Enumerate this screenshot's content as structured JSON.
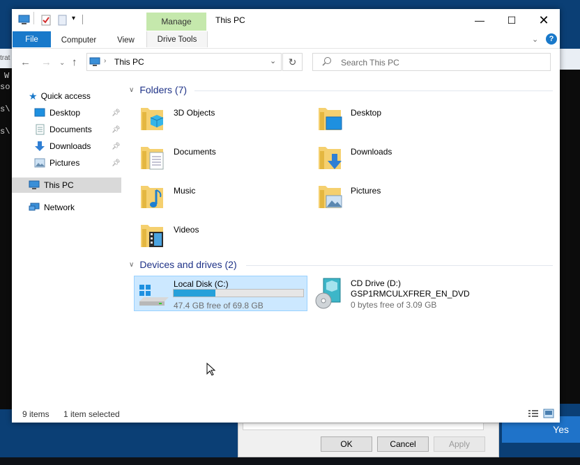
{
  "background": {
    "terminal_lines": [
      "W",
      "so",
      "s\\",
      "s\\"
    ],
    "top_strip": "trat",
    "yes_label": "Yes",
    "dialog": {
      "ok": "OK",
      "cancel": "Cancel",
      "apply": "Apply"
    }
  },
  "window": {
    "title": "This PC",
    "contextual_tab": "Manage",
    "ribbon_tabs": [
      "File",
      "Computer",
      "View",
      "Drive Tools"
    ],
    "help": "?"
  },
  "address": {
    "location": "This PC",
    "search_placeholder": "Search This PC"
  },
  "nav": {
    "quick_access": "Quick access",
    "pinned": [
      "Desktop",
      "Documents",
      "Downloads",
      "Pictures"
    ],
    "this_pc": "This PC",
    "network": "Network"
  },
  "content": {
    "folders_header": "Folders (7)",
    "folders": [
      "3D Objects",
      "Desktop",
      "Documents",
      "Downloads",
      "Music",
      "Pictures",
      "Videos"
    ],
    "devices_header": "Devices and drives (2)",
    "drives": [
      {
        "name": "Local Disk (C:)",
        "free": "47.4 GB free of 69.8 GB",
        "used_fraction": 0.32
      },
      {
        "name": "CD Drive (D:)",
        "label": "GSP1RMCULXFRER_EN_DVD",
        "free": "0 bytes free of 3.09 GB"
      }
    ]
  },
  "status": {
    "items": "9 items",
    "selected": "1 item selected"
  },
  "colors": {
    "accent": "#1979ca",
    "manage": "#c5e8ac",
    "selection": "#cce8ff",
    "progress": "#26a0da",
    "folder": "#f5d06f"
  }
}
